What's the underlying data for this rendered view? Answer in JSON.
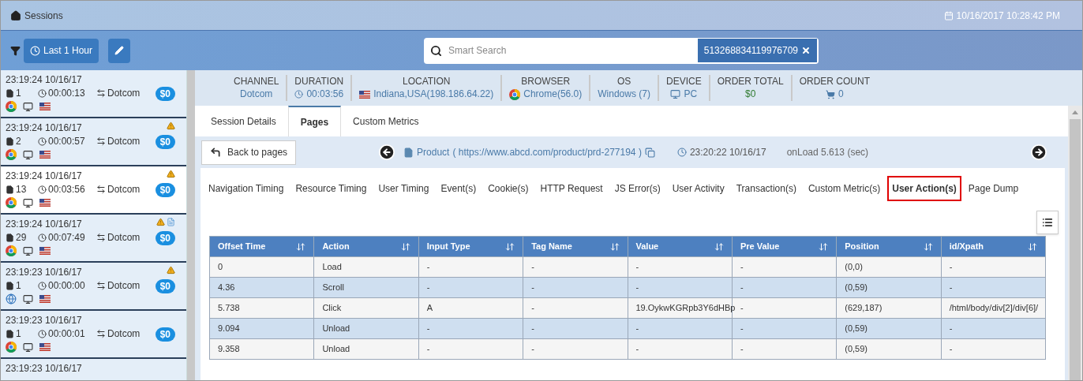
{
  "header": {
    "title": "Sessions",
    "datetime": "10/16/2017 10:28:42 PM"
  },
  "toolbar": {
    "time_range": "Last 1 Hour",
    "search": {
      "placeholder": "Smart Search"
    },
    "search_token": "513268834119976709"
  },
  "sessions": [
    {
      "time": "23:19:24 10/16/17",
      "pages": "1",
      "duration": "00:00:13",
      "channel": "Dotcom",
      "amount": "$0",
      "warning": false,
      "extra_flag": false,
      "kind": "chrome",
      "selected": false
    },
    {
      "time": "23:19:24 10/16/17",
      "pages": "2",
      "duration": "00:00:57",
      "channel": "Dotcom",
      "amount": "$0",
      "warning": true,
      "extra_flag": false,
      "kind": "chrome",
      "selected": false
    },
    {
      "time": "23:19:24 10/16/17",
      "pages": "13",
      "duration": "00:03:56",
      "channel": "Dotcom",
      "amount": "$0",
      "warning": true,
      "extra_flag": false,
      "kind": "chrome",
      "selected": true
    },
    {
      "time": "23:19:24 10/16/17",
      "pages": "29",
      "duration": "00:07:49",
      "channel": "Dotcom",
      "amount": "$0",
      "warning": true,
      "extra_flag": true,
      "kind": "chrome",
      "selected": false
    },
    {
      "time": "23:19:23 10/16/17",
      "pages": "1",
      "duration": "00:00:00",
      "channel": "Dotcom",
      "amount": "$0",
      "warning": true,
      "extra_flag": false,
      "kind": "other",
      "selected": false
    },
    {
      "time": "23:19:23 10/16/17",
      "pages": "1",
      "duration": "00:00:01",
      "channel": "Dotcom",
      "amount": "$0",
      "warning": false,
      "extra_flag": false,
      "kind": "chrome",
      "selected": false
    },
    {
      "time": "23:19:23 10/16/17"
    }
  ],
  "summary": [
    {
      "label": "CHANNEL",
      "value": "Dotcom",
      "kind": "text"
    },
    {
      "label": "DURATION",
      "value": "00:03:56",
      "kind": "duration"
    },
    {
      "label": "LOCATION",
      "value": "Indiana,USA(198.186.64.22)",
      "kind": "location"
    },
    {
      "label": "BROWSER",
      "value": "Chrome(56.0)",
      "kind": "browser"
    },
    {
      "label": "OS",
      "value": "Windows (7)",
      "kind": "text"
    },
    {
      "label": "DEVICE",
      "value": "PC",
      "kind": "device"
    },
    {
      "label": "ORDER TOTAL",
      "value": "$0",
      "kind": "money"
    },
    {
      "label": "ORDER COUNT",
      "value": "0",
      "kind": "count"
    }
  ],
  "tabs": [
    {
      "label": "Session Details",
      "selected": false
    },
    {
      "label": "Pages",
      "selected": true
    },
    {
      "label": "Custom Metrics",
      "selected": false
    }
  ],
  "page_nav": {
    "back": "Back to pages",
    "page": "Product",
    "url": "( https://www.abcd.com/product/prd-277194 )",
    "time": "23:20:22 10/16/17",
    "onload": "onLoad 5.613 (sec)"
  },
  "subtabs": [
    {
      "label": "Navigation Timing",
      "selected": false
    },
    {
      "label": "Resource Timing",
      "selected": false
    },
    {
      "label": "User Timing",
      "selected": false
    },
    {
      "label": "Event(s)",
      "selected": false
    },
    {
      "label": "Cookie(s)",
      "selected": false
    },
    {
      "label": "HTTP Request",
      "selected": false
    },
    {
      "label": "JS Error(s)",
      "selected": false
    },
    {
      "label": "User Activity",
      "selected": false
    },
    {
      "label": "Transaction(s)",
      "selected": false
    },
    {
      "label": "Custom Metric(s)",
      "selected": false
    },
    {
      "label": "User Action(s)",
      "selected": true
    },
    {
      "label": "Page Dump",
      "selected": false
    }
  ],
  "table": {
    "columns": [
      "Offset Time",
      "Action",
      "Input Type",
      "Tag Name",
      "Value",
      "Pre Value",
      "Position",
      "id/Xpath"
    ],
    "rows": [
      [
        "0",
        "Load",
        "-",
        "-",
        "-",
        "-",
        "(0,0)",
        "-"
      ],
      [
        "4.36",
        "Scroll",
        "-",
        "-",
        "-",
        "-",
        "(0,59)",
        "-"
      ],
      [
        "5.738",
        "Click",
        "A",
        "-",
        "19.OykwKGRpb3Y6dHBp",
        "-",
        "(629,187)",
        "/html/body/div[2]/div[6]/"
      ],
      [
        "9.094",
        "Unload",
        "-",
        "-",
        "-",
        "-",
        "(0,59)",
        "-"
      ],
      [
        "9.358",
        "Unload",
        "-",
        "-",
        "-",
        "-",
        "(0,59)",
        "-"
      ]
    ]
  }
}
